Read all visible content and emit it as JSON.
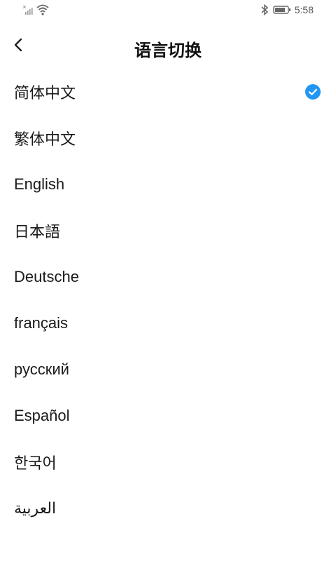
{
  "status_bar": {
    "time": "5:58",
    "icons": [
      "no-sim-signal-icon",
      "wifi-icon",
      "bluetooth-icon",
      "battery-icon"
    ]
  },
  "header": {
    "back_icon": "chevron-left-icon",
    "title": "语言切换"
  },
  "languages": [
    {
      "label": "简体中文",
      "selected": true
    },
    {
      "label": "繁体中文",
      "selected": false
    },
    {
      "label": "English",
      "selected": false
    },
    {
      "label": "日本語",
      "selected": false
    },
    {
      "label": "Deutsche",
      "selected": false
    },
    {
      "label": "français",
      "selected": false
    },
    {
      "label": "русский",
      "selected": false
    },
    {
      "label": "Español",
      "selected": false
    },
    {
      "label": "한국어",
      "selected": false
    },
    {
      "label": "العربية",
      "selected": false
    }
  ],
  "colors": {
    "accent": "#2196F3",
    "text": "#1a1a1a",
    "background": "#ffffff"
  }
}
